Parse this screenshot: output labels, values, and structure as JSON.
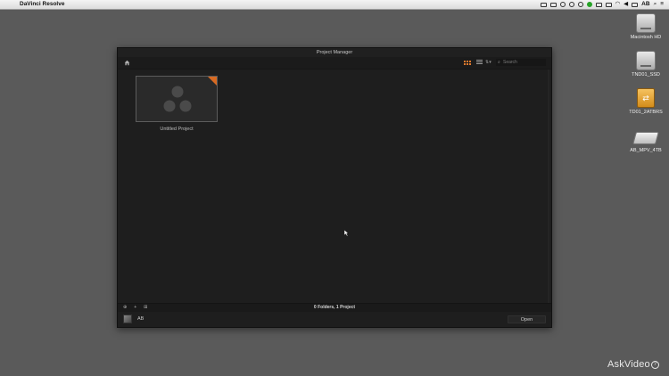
{
  "menubar": {
    "app_name": "DaVinci Resolve",
    "user": "AB",
    "status_icons": [
      "screen-icon",
      "film-icon",
      "sync-icon",
      "time-machine-icon",
      "audio-icon",
      "spotify-icon",
      "volume-low-icon",
      "shield-icon",
      "wifi-icon",
      "speaker-icon",
      "battery-icon"
    ]
  },
  "desktop": {
    "items": [
      {
        "label": "Macintosh HD",
        "icon": "hard-drive-icon"
      },
      {
        "label": "TND01_SSD",
        "icon": "hard-drive-icon"
      },
      {
        "label": "TD01_2ATBRS",
        "icon": "external-drive-icon"
      },
      {
        "label": "AB_MPV_4TB",
        "icon": "external-drive-icon"
      }
    ]
  },
  "project_manager": {
    "title": "Project Manager",
    "search_placeholder": "Search",
    "view_sort_label": "⇅▾",
    "projects": [
      {
        "name": "Untitled Project",
        "badge": "current-project-marker"
      }
    ],
    "status_text": "0 Folders, 1 Project",
    "user_name": "AB",
    "open_label": "Open",
    "colors": {
      "accent": "#e07a2e",
      "background": "#1e1e1e"
    }
  },
  "watermark": {
    "text": "AskVideo",
    "bubble": "?"
  }
}
